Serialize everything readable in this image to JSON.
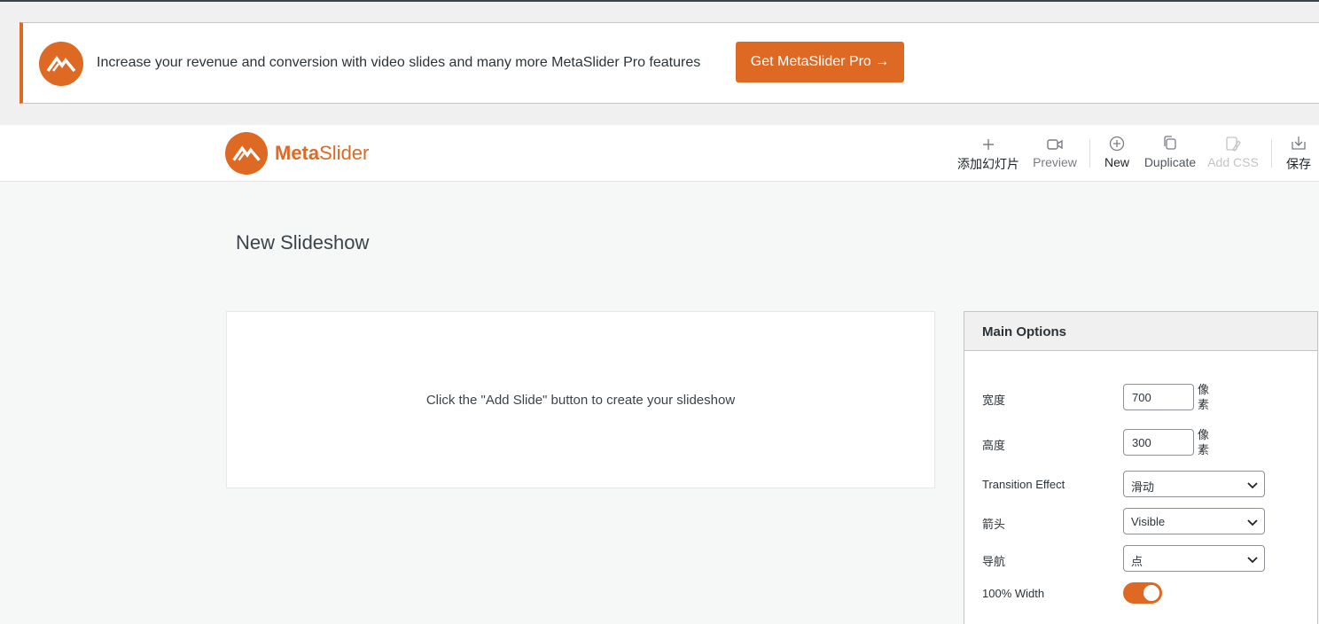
{
  "colors": {
    "accent": "#dd6923"
  },
  "notice": {
    "logo_icon": "metaslider-logo-icon",
    "text": "Increase your revenue and conversion with video slides and many more MetaSlider Pro features",
    "button": "Get MetaSlider Pro →"
  },
  "header": {
    "brand_bold": "Meta",
    "brand_light": "Slider",
    "toolbar": {
      "add_slide": {
        "icon": "plus-icon",
        "label": "添加幻灯片"
      },
      "preview": {
        "icon": "video-camera-icon",
        "label": "Preview"
      },
      "new": {
        "icon": "plus-circle-icon",
        "label": "New"
      },
      "duplicate": {
        "icon": "copy-icon",
        "label": "Duplicate"
      },
      "add_css": {
        "icon": "css-icon",
        "label": "Add CSS",
        "disabled": true
      },
      "save": {
        "icon": "download-icon",
        "label": "保存"
      }
    }
  },
  "main": {
    "title": "New Slideshow",
    "empty_message": "Click the \"Add Slide\" button to create your slideshow"
  },
  "options": {
    "heading": "Main Options",
    "width": {
      "label": "宽度",
      "value": "700",
      "unit": "像素"
    },
    "height": {
      "label": "高度",
      "value": "300",
      "unit": "像素"
    },
    "transition": {
      "label": "Transition Effect",
      "value": "滑动"
    },
    "arrows": {
      "label": "箭头",
      "value": "Visible"
    },
    "navigation": {
      "label": "导航",
      "value": "点"
    },
    "full_width": {
      "label": "100% Width",
      "enabled": true
    }
  }
}
